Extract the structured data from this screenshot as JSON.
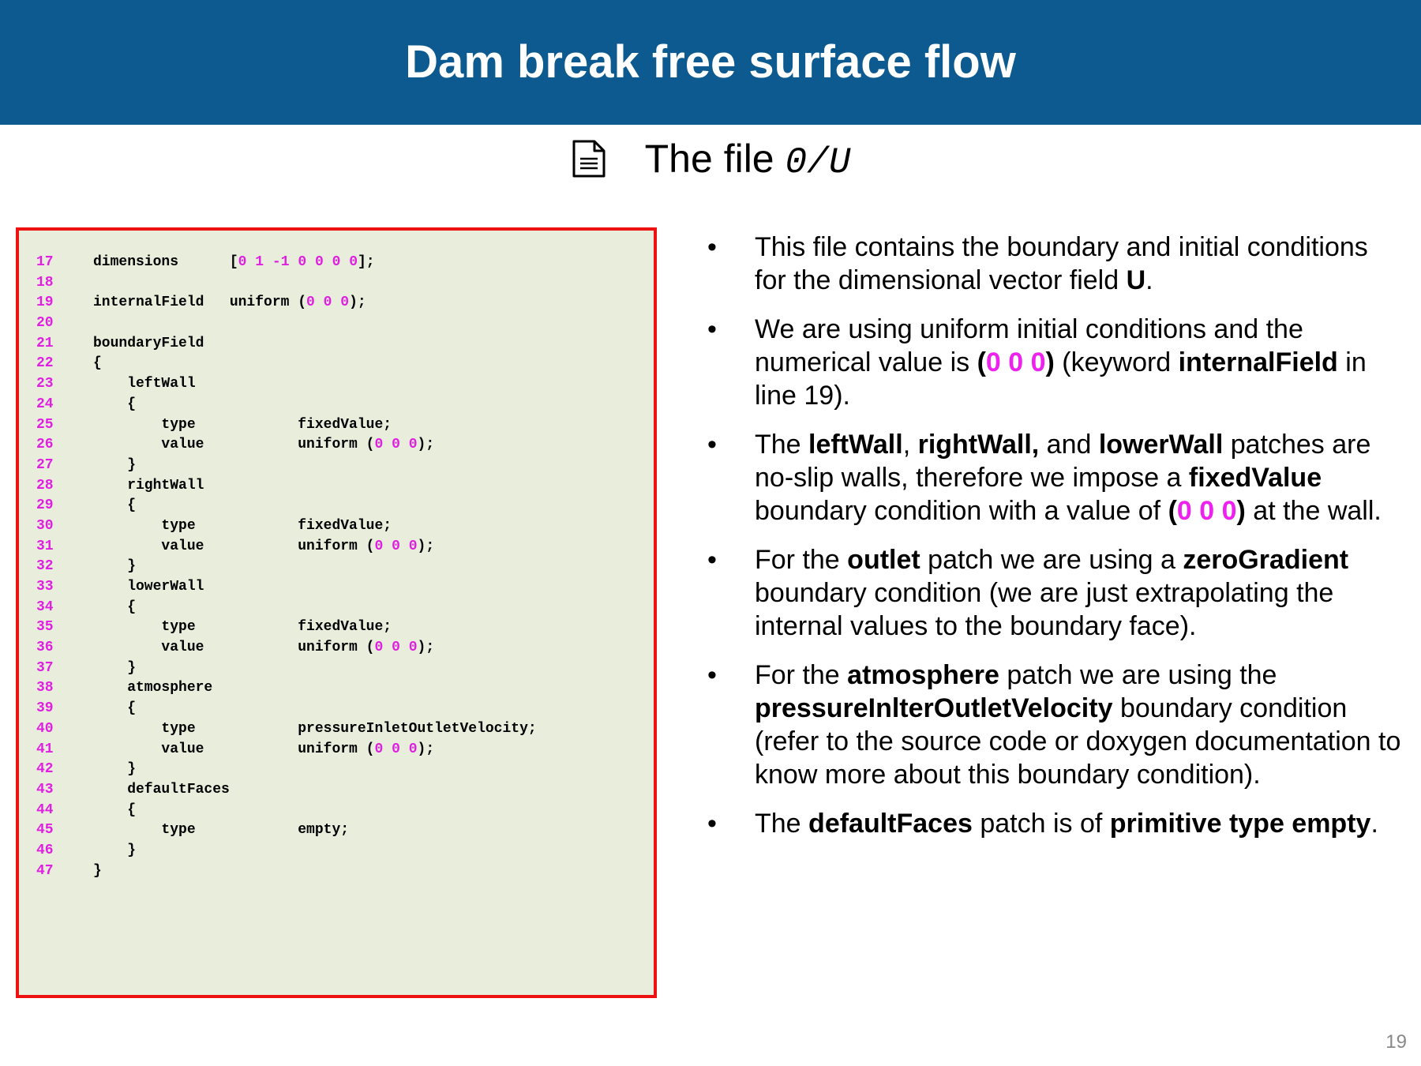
{
  "header": {
    "title": "Dam break free surface flow"
  },
  "subtitle": {
    "prefix": "The file",
    "filename": "0/U",
    "icon": "document-icon"
  },
  "code": [
    {
      "n": "17",
      "t": "dimensions      [0 1 -1 0 0 0 0];"
    },
    {
      "n": "18",
      "t": ""
    },
    {
      "n": "19",
      "t": "internalField   uniform (0 0 0);"
    },
    {
      "n": "20",
      "t": ""
    },
    {
      "n": "21",
      "t": "boundaryField"
    },
    {
      "n": "22",
      "t": "{"
    },
    {
      "n": "23",
      "t": "    leftWall"
    },
    {
      "n": "24",
      "t": "    {"
    },
    {
      "n": "25",
      "t": "        type            fixedValue;"
    },
    {
      "n": "26",
      "t": "        value           uniform (0 0 0);"
    },
    {
      "n": "27",
      "t": "    }"
    },
    {
      "n": "28",
      "t": "    rightWall"
    },
    {
      "n": "29",
      "t": "    {"
    },
    {
      "n": "30",
      "t": "        type            fixedValue;"
    },
    {
      "n": "31",
      "t": "        value           uniform (0 0 0);"
    },
    {
      "n": "32",
      "t": "    }"
    },
    {
      "n": "33",
      "t": "    lowerWall"
    },
    {
      "n": "34",
      "t": "    {"
    },
    {
      "n": "35",
      "t": "        type            fixedValue;"
    },
    {
      "n": "36",
      "t": "        value           uniform (0 0 0);"
    },
    {
      "n": "37",
      "t": "    }"
    },
    {
      "n": "38",
      "t": "    atmosphere"
    },
    {
      "n": "39",
      "t": "    {"
    },
    {
      "n": "40",
      "t": "        type            pressureInletOutletVelocity;"
    },
    {
      "n": "41",
      "t": "        value           uniform (0 0 0);"
    },
    {
      "n": "42",
      "t": "    }"
    },
    {
      "n": "43",
      "t": "    defaultFaces"
    },
    {
      "n": "44",
      "t": "    {"
    },
    {
      "n": "45",
      "t": "        type            empty;"
    },
    {
      "n": "46",
      "t": "    }"
    },
    {
      "n": "47",
      "t": "}"
    }
  ],
  "bullet_marker": "•",
  "bullets": [
    {
      "segs": [
        {
          "t": "This file contains the boundary and initial conditions for the dimensional vector field "
        },
        {
          "t": "U",
          "b": true
        },
        {
          "t": "."
        }
      ]
    },
    {
      "segs": [
        {
          "t": "We are using uniform initial conditions and the numerical value is "
        },
        {
          "t": "(",
          "b": true
        },
        {
          "t": "0 0 0",
          "b": true,
          "m": true
        },
        {
          "t": ")",
          "b": true
        },
        {
          "t": " (keyword "
        },
        {
          "t": "internalField",
          "b": true
        },
        {
          "t": " in line 19)."
        }
      ]
    },
    {
      "segs": [
        {
          "t": "The "
        },
        {
          "t": "leftWall",
          "b": true
        },
        {
          "t": ", "
        },
        {
          "t": "rightWall,",
          "b": true
        },
        {
          "t": " and "
        },
        {
          "t": "lowerWall",
          "b": true
        },
        {
          "t": " patches are no-slip walls, therefore we impose a "
        },
        {
          "t": "fixedValue",
          "b": true
        },
        {
          "t": " boundary condition with a value of "
        },
        {
          "t": "(",
          "b": true
        },
        {
          "t": "0 0 0",
          "b": true,
          "m": true
        },
        {
          "t": ")",
          "b": true
        },
        {
          "t": " at the wall."
        }
      ]
    },
    {
      "segs": [
        {
          "t": "For the "
        },
        {
          "t": "outlet",
          "b": true
        },
        {
          "t": " patch we are using a "
        },
        {
          "t": "zeroGradient",
          "b": true
        },
        {
          "t": " boundary condition (we are just extrapolating the internal values to the boundary face)."
        }
      ]
    },
    {
      "segs": [
        {
          "t": "For the "
        },
        {
          "t": "atmosphere",
          "b": true
        },
        {
          "t": " patch we are using the "
        },
        {
          "t": "pressureInlterOutletVelocity",
          "b": true
        },
        {
          "t": " boundary condition (refer to the source code or doxygen documentation to know more about this boundary condition)."
        }
      ]
    },
    {
      "segs": [
        {
          "t": "The "
        },
        {
          "t": "defaultFaces",
          "b": true
        },
        {
          "t": " patch is of "
        },
        {
          "t": "primitive type empty",
          "b": true
        },
        {
          "t": "."
        }
      ]
    }
  ],
  "page_number": "19",
  "colors": {
    "header_bg": "#0c5a8f",
    "code_bg": "#e9eedc",
    "code_border": "#ee1111",
    "highlight": "#ee22ee"
  }
}
